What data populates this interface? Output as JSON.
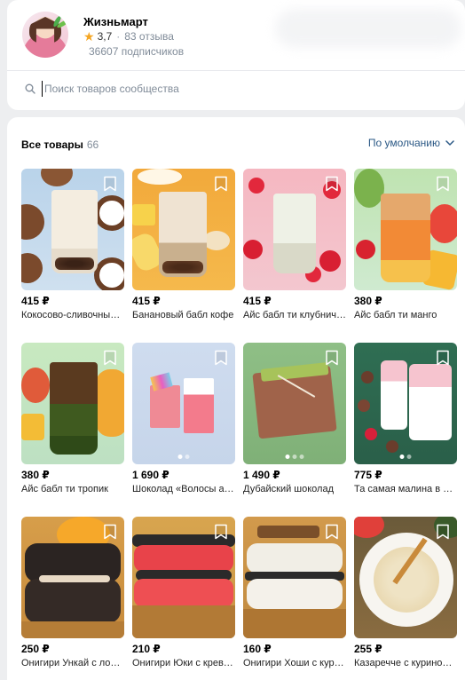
{
  "shop": {
    "name": "Жизньмарт",
    "rating": "3,7",
    "reviews": "83 отзыва",
    "subscribers": "36607 подписчиков"
  },
  "search": {
    "placeholder": "Поиск товаров сообщества"
  },
  "products": {
    "heading": "Все товары",
    "count": "66",
    "sort_label": "По умолчанию",
    "items": [
      {
        "price": "415 ₽",
        "title": "Кокосово-сливочный бабл ти"
      },
      {
        "price": "415 ₽",
        "title": "Банановый бабл кофе"
      },
      {
        "price": "415 ₽",
        "title": "Айс бабл ти клубничный"
      },
      {
        "price": "380 ₽",
        "title": "Айс бабл ти манго"
      },
      {
        "price": "380 ₽",
        "title": "Айс бабл ти тропик"
      },
      {
        "price": "1 690 ₽",
        "title": "Шоколад «Волосы ангела»"
      },
      {
        "price": "1 490 ₽",
        "title": "Дубайский шоколад"
      },
      {
        "price": "775 ₽",
        "title": "Та самая малина в шоколаде"
      },
      {
        "price": "250 ₽",
        "title": "Онигири Ункай с лососем"
      },
      {
        "price": "210 ₽",
        "title": "Онигири Юки с креветкой"
      },
      {
        "price": "160 ₽",
        "title": "Онигири Хоши с курицей"
      },
      {
        "price": "255 ₽",
        "title": "Казаречче с куриной грудкой"
      }
    ]
  },
  "colors": {
    "link": "#2a5885",
    "muted": "#818c99",
    "star": "#f5a623"
  },
  "icons": [
    "search-icon",
    "star-icon",
    "chevron-down-icon",
    "bookmark-icon"
  ]
}
